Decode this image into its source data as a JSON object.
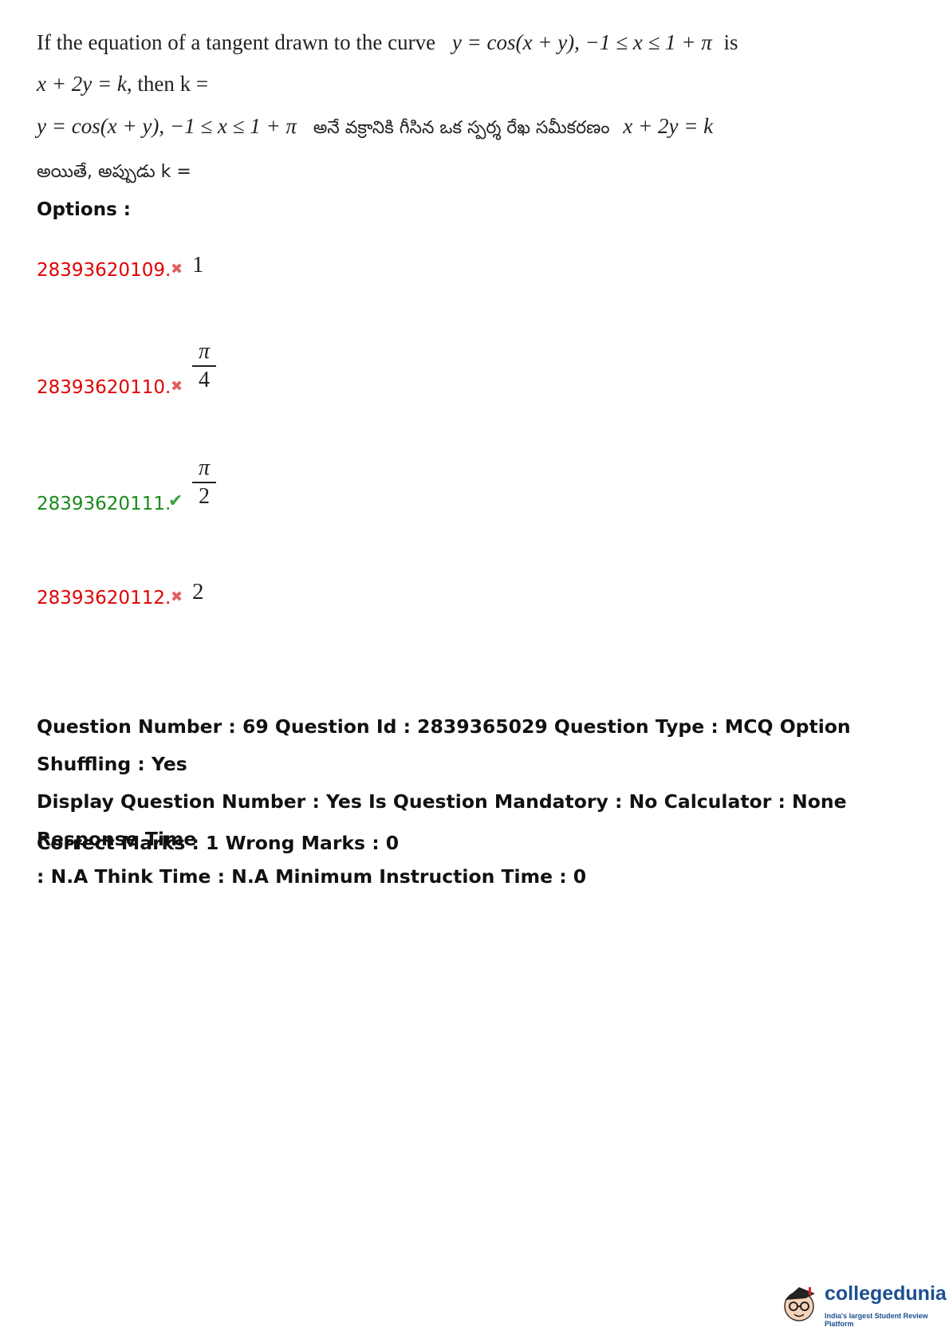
{
  "question": {
    "line1_text": "If the equation of a tangent drawn to the curve",
    "line1_math": "y = cos(x + y), −1 ≤ x ≤ 1 + π",
    "line1_end": "is",
    "line2_math": "x + 2y = k",
    "line2_text": ", then k =",
    "line3_math": "y = cos(x + y), −1 ≤ x ≤ 1 + π",
    "line3_telugu": "అనే వక్రానికి గీసిన ఒక స్పర్శ రేఖ సమీకరణం",
    "line3_math2": "x + 2y = k",
    "line4_telugu": "అయితే, అప్పుడు k ="
  },
  "options_label": "Options :",
  "options": [
    {
      "id": "28393620109.",
      "status": "wrong",
      "value": "1"
    },
    {
      "id": "28393620110.",
      "status": "wrong",
      "num": "π",
      "den": "4"
    },
    {
      "id": "28393620111.",
      "status": "correct",
      "num": "π",
      "den": "2"
    },
    {
      "id": "28393620112.",
      "status": "wrong",
      "value": "2"
    }
  ],
  "meta": {
    "line1": "Question Number : 69 Question Id : 2839365029 Question Type : MCQ Option Shuffling : Yes",
    "line2": "Display Question Number : Yes Is Question Mandatory : No Calculator : None Response Time",
    "line3": ": N.A Think Time : N.A Minimum Instruction Time : 0"
  },
  "marks": "Correct Marks : 1 Wrong Marks : 0",
  "logo": {
    "name": "collegedunia",
    "tagline": "India's largest Student Review Platform"
  },
  "colors": {
    "wrong": "#e00000",
    "correct": "#1a8a1a",
    "brand": "#1c4f8f"
  }
}
